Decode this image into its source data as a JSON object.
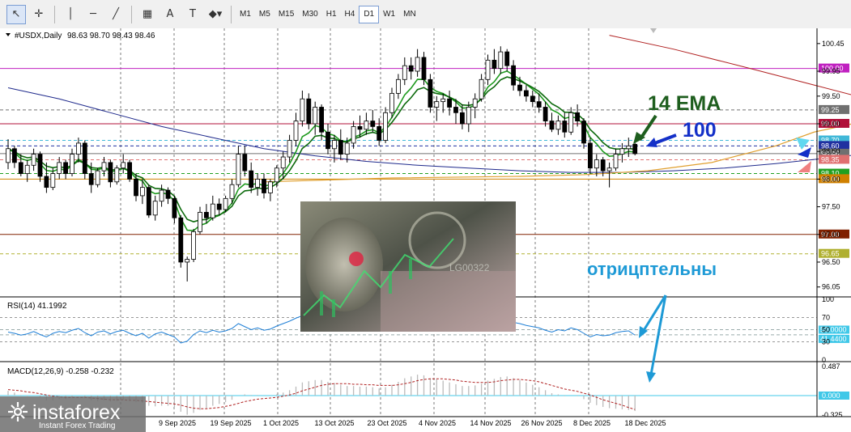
{
  "toolbar": {
    "tools": [
      {
        "name": "cursor-tool",
        "glyph": "↖"
      },
      {
        "name": "crosshair-tool",
        "glyph": "✛"
      },
      {
        "name": "vertical-line-tool",
        "glyph": "│"
      },
      {
        "name": "horizontal-line-tool",
        "glyph": "─"
      },
      {
        "name": "trendline-tool",
        "glyph": "╱"
      },
      {
        "name": "channel-tool",
        "glyph": "▦"
      },
      {
        "name": "text-tool",
        "glyph": "A"
      },
      {
        "name": "label-tool",
        "glyph": "T"
      },
      {
        "name": "shapes-tool",
        "glyph": "◆▾"
      }
    ],
    "timeframes": [
      "M1",
      "M5",
      "M15",
      "M30",
      "H1",
      "H4",
      "D1",
      "W1",
      "MN"
    ],
    "active_timeframe": "D1"
  },
  "chart_title": "#USDX,Daily",
  "ohlc_text": "98.63 98.70 98.43 98.46",
  "rsi_title": "RSI(14) 41.1992",
  "macd_title": "MACD(12,26,9) -0.258 -0.232",
  "annotations": {
    "ema": "14 EMA",
    "ma100": "100",
    "negative": "отрицптельны"
  },
  "watermark": {
    "brand": "instaforex",
    "tagline": "Instant Forex Trading"
  },
  "colors": {
    "bull": "#ffffff",
    "bear": "#000000",
    "ema14": "#1e9a1e",
    "ma100": "#1f2a8c",
    "ma200": "#e0a030",
    "ma_red": "#b02020",
    "rsi": "#1e7fd6",
    "macd": "#b02020",
    "annotation_green": "#1e5e1e",
    "annotation_blue": "#1430c8",
    "annotation_cyan": "#1e9ad6"
  },
  "chart_data": {
    "type": "candlestick",
    "ylim": [
      95.9,
      100.55
    ],
    "price_ticks": [
      100.45,
      99.95,
      99.5,
      99.0,
      98.5,
      98.0,
      97.5,
      97.0,
      96.5,
      96.05
    ],
    "x_labels": [
      "9 Sep 2025",
      "19 Sep 2025",
      "1 Oct 2025",
      "13 Oct 2025",
      "23 Oct 2025",
      "4 Nov 2025",
      "14 Nov 2025",
      "26 Nov 2025",
      "8 Dec 2025",
      "18 Dec 2025"
    ],
    "candles": [
      [
        98.3,
        98.72,
        98.18,
        98.55
      ],
      [
        98.55,
        98.6,
        98.2,
        98.3
      ],
      [
        98.3,
        98.45,
        98.05,
        98.1
      ],
      [
        98.1,
        98.35,
        97.95,
        98.25
      ],
      [
        98.25,
        98.55,
        98.15,
        98.45
      ],
      [
        98.45,
        98.5,
        97.95,
        98.05
      ],
      [
        98.05,
        98.3,
        97.75,
        97.85
      ],
      [
        97.85,
        98.2,
        97.8,
        98.1
      ],
      [
        98.1,
        98.4,
        98.0,
        98.3
      ],
      [
        98.3,
        98.35,
        98.0,
        98.1
      ],
      [
        98.1,
        98.55,
        98.05,
        98.45
      ],
      [
        98.45,
        98.75,
        98.3,
        98.65
      ],
      [
        98.65,
        98.7,
        98.0,
        98.1
      ],
      [
        98.1,
        98.3,
        97.75,
        97.9
      ],
      [
        97.9,
        98.2,
        97.85,
        98.15
      ],
      [
        98.15,
        98.4,
        98.05,
        98.3
      ],
      [
        98.3,
        98.35,
        97.85,
        97.95
      ],
      [
        97.95,
        98.25,
        97.9,
        98.2
      ],
      [
        98.2,
        98.45,
        98.1,
        98.3
      ],
      [
        98.3,
        98.35,
        97.95,
        98.0
      ],
      [
        98.0,
        98.1,
        97.6,
        97.7
      ],
      [
        97.7,
        98.0,
        97.55,
        97.85
      ],
      [
        97.85,
        97.9,
        97.3,
        97.35
      ],
      [
        97.35,
        97.7,
        97.25,
        97.6
      ],
      [
        97.6,
        97.9,
        97.5,
        97.8
      ],
      [
        97.8,
        97.85,
        97.55,
        97.65
      ],
      [
        97.65,
        97.7,
        97.2,
        97.3
      ],
      [
        97.3,
        97.35,
        96.4,
        96.5
      ],
      [
        96.5,
        96.6,
        96.15,
        96.55
      ],
      [
        96.55,
        97.1,
        96.5,
        97.05
      ],
      [
        97.05,
        97.5,
        97.0,
        97.4
      ],
      [
        97.4,
        97.55,
        97.2,
        97.3
      ],
      [
        97.3,
        97.7,
        97.25,
        97.55
      ],
      [
        97.55,
        97.65,
        97.35,
        97.45
      ],
      [
        97.45,
        97.7,
        97.4,
        97.65
      ],
      [
        97.65,
        98.0,
        97.55,
        97.9
      ],
      [
        97.9,
        98.6,
        97.85,
        98.45
      ],
      [
        98.45,
        98.6,
        98.05,
        98.15
      ],
      [
        98.15,
        98.3,
        97.75,
        97.85
      ],
      [
        97.85,
        98.1,
        97.7,
        98.0
      ],
      [
        98.0,
        98.1,
        97.65,
        97.75
      ],
      [
        97.75,
        98.0,
        97.6,
        97.95
      ],
      [
        97.95,
        98.25,
        97.85,
        98.2
      ],
      [
        98.2,
        98.5,
        98.0,
        98.4
      ],
      [
        98.4,
        98.8,
        98.3,
        98.7
      ],
      [
        98.7,
        99.2,
        98.6,
        99.05
      ],
      [
        99.05,
        99.6,
        98.95,
        99.45
      ],
      [
        99.45,
        99.55,
        98.9,
        99.0
      ],
      [
        99.0,
        99.4,
        98.8,
        99.3
      ],
      [
        99.3,
        99.35,
        98.7,
        98.85
      ],
      [
        98.85,
        99.0,
        98.45,
        98.55
      ],
      [
        98.55,
        98.8,
        98.3,
        98.7
      ],
      [
        98.7,
        98.9,
        98.35,
        98.45
      ],
      [
        98.45,
        98.75,
        98.3,
        98.65
      ],
      [
        98.65,
        99.05,
        98.55,
        98.95
      ],
      [
        98.95,
        99.15,
        98.75,
        98.9
      ],
      [
        98.9,
        99.2,
        98.8,
        99.05
      ],
      [
        99.05,
        99.25,
        98.85,
        98.95
      ],
      [
        98.95,
        99.1,
        98.6,
        98.7
      ],
      [
        98.7,
        99.3,
        98.65,
        99.2
      ],
      [
        99.2,
        99.65,
        99.1,
        99.55
      ],
      [
        99.55,
        99.9,
        99.45,
        99.8
      ],
      [
        99.8,
        100.2,
        99.7,
        100.05
      ],
      [
        100.05,
        100.2,
        99.8,
        99.95
      ],
      [
        99.95,
        100.35,
        99.85,
        100.2
      ],
      [
        100.2,
        100.3,
        99.7,
        99.8
      ],
      [
        99.8,
        99.9,
        99.2,
        99.3
      ],
      [
        99.3,
        99.5,
        99.05,
        99.4
      ],
      [
        99.4,
        99.55,
        99.2,
        99.45
      ],
      [
        99.45,
        99.6,
        99.15,
        99.3
      ],
      [
        99.3,
        99.45,
        99.0,
        99.2
      ],
      [
        99.2,
        99.35,
        98.9,
        99.0
      ],
      [
        99.0,
        99.4,
        98.85,
        99.3
      ],
      [
        99.3,
        99.55,
        99.1,
        99.45
      ],
      [
        99.45,
        99.9,
        99.4,
        99.8
      ],
      [
        99.8,
        100.25,
        99.7,
        100.15
      ],
      [
        100.15,
        100.35,
        99.9,
        100.0
      ],
      [
        100.0,
        100.4,
        99.9,
        100.3
      ],
      [
        100.3,
        100.35,
        99.95,
        100.05
      ],
      [
        100.05,
        100.15,
        99.6,
        99.7
      ],
      [
        99.7,
        99.85,
        99.5,
        99.6
      ],
      [
        99.6,
        99.7,
        99.4,
        99.5
      ],
      [
        99.5,
        99.6,
        99.3,
        99.4
      ],
      [
        99.4,
        99.55,
        99.2,
        99.3
      ],
      [
        99.3,
        99.4,
        98.95,
        99.05
      ],
      [
        99.05,
        99.2,
        98.85,
        98.9
      ],
      [
        98.9,
        99.15,
        98.8,
        99.05
      ],
      [
        99.05,
        99.2,
        98.75,
        98.85
      ],
      [
        98.85,
        99.3,
        98.8,
        99.2
      ],
      [
        99.2,
        99.35,
        98.95,
        99.05
      ],
      [
        99.05,
        99.1,
        98.55,
        98.65
      ],
      [
        98.65,
        98.75,
        98.1,
        98.2
      ],
      [
        98.2,
        98.45,
        98.05,
        98.35
      ],
      [
        98.35,
        98.4,
        98.05,
        98.15
      ],
      [
        98.15,
        98.3,
        97.85,
        98.2
      ],
      [
        98.2,
        98.55,
        98.15,
        98.45
      ],
      [
        98.45,
        98.65,
        98.3,
        98.55
      ],
      [
        98.55,
        98.75,
        98.4,
        98.6
      ],
      [
        98.63,
        98.7,
        98.43,
        98.46
      ]
    ],
    "horizontal_levels": [
      {
        "price": 100.0,
        "color": "#c020c0",
        "style": "solid",
        "label": "100.00"
      },
      {
        "price": 99.25,
        "color": "#707070",
        "style": "dash",
        "label": "99.25"
      },
      {
        "price": 99.0,
        "color": "#b0103a",
        "style": "solid",
        "label": "99.00"
      },
      {
        "price": 98.7,
        "color": "#40b8d8",
        "style": "dash",
        "label": "98.70"
      },
      {
        "price": 98.6,
        "color": "#2030a0",
        "style": "dash",
        "label": "98.60"
      },
      {
        "price": 98.46,
        "color": "#707070",
        "style": "solid",
        "label": "98.46"
      },
      {
        "price": 98.35,
        "color": "#e07070",
        "style": "dash",
        "label": "98.35"
      },
      {
        "price": 98.1,
        "color": "#20a020",
        "style": "dash",
        "label": "98.10"
      },
      {
        "price": 98.0,
        "color": "#d08000",
        "style": "solid",
        "label": "98.00"
      },
      {
        "price": 97.0,
        "color": "#802000",
        "style": "solid",
        "label": "97.00"
      },
      {
        "price": 96.65,
        "color": "#b0b030",
        "style": "dash",
        "label": "96.65"
      }
    ],
    "ma100": [
      [
        0,
        99.65
      ],
      [
        8,
        99.45
      ],
      [
        16,
        99.2
      ],
      [
        24,
        98.95
      ],
      [
        32,
        98.75
      ],
      [
        40,
        98.55
      ],
      [
        48,
        98.42
      ],
      [
        56,
        98.32
      ],
      [
        64,
        98.25
      ],
      [
        72,
        98.2
      ],
      [
        80,
        98.15
      ],
      [
        88,
        98.12
      ],
      [
        96,
        98.12
      ],
      [
        104,
        98.15
      ],
      [
        112,
        98.2
      ],
      [
        120,
        98.28
      ],
      [
        128,
        98.38
      ],
      [
        136,
        98.48
      ],
      [
        144,
        98.55
      ],
      [
        152,
        98.58
      ],
      [
        160,
        98.6
      ]
    ],
    "ma200": [
      [
        40,
        97.95
      ],
      [
        60,
        98.02
      ],
      [
        80,
        98.05
      ],
      [
        90,
        98.08
      ],
      [
        100,
        98.15
      ],
      [
        110,
        98.3
      ],
      [
        120,
        98.6
      ],
      [
        126,
        98.85
      ],
      [
        132,
        99.0
      ],
      [
        138,
        99.15
      ],
      [
        144,
        99.22
      ],
      [
        150,
        99.2
      ],
      [
        157,
        99.15
      ]
    ],
    "ma_red": [
      [
        94,
        100.6
      ],
      [
        104,
        100.35
      ],
      [
        116,
        100.0
      ],
      [
        126,
        99.7
      ],
      [
        136,
        99.4
      ],
      [
        144,
        99.2
      ],
      [
        150,
        99.1
      ],
      [
        157,
        99.1
      ]
    ],
    "rsi": {
      "ticks": [
        100,
        70,
        50,
        30,
        0
      ],
      "levels": [
        {
          "value": 50.0,
          "label": "50.0000",
          "color": "#40c8e8"
        },
        {
          "value": 41.44,
          "label": "41.4400",
          "color": "#40c8e8"
        }
      ],
      "values": [
        46,
        44,
        41,
        43,
        47,
        42,
        38,
        44,
        47,
        45,
        49,
        52,
        45,
        40,
        46,
        48,
        43,
        47,
        49,
        44,
        40,
        44,
        36,
        43,
        46,
        42,
        38,
        28,
        31,
        42,
        48,
        45,
        49,
        46,
        48,
        52,
        60,
        55,
        50,
        53,
        49,
        51,
        56,
        60,
        64,
        69,
        73,
        66,
        68,
        62,
        56,
        59,
        55,
        58,
        62,
        61,
        63,
        60,
        57,
        64,
        69,
        73,
        76,
        72,
        74,
        66,
        59,
        61,
        62,
        60,
        57,
        55,
        60,
        63,
        68,
        72,
        70,
        72,
        67,
        62,
        60,
        57,
        55,
        53,
        49,
        46,
        50,
        48,
        53,
        50,
        44,
        38,
        42,
        40,
        41,
        45,
        47,
        48,
        41
      ]
    },
    "macd": {
      "ticks": [
        0.487,
        0.0,
        -0.325
      ],
      "zero_label": "0.000",
      "hist": [
        0.08,
        0.05,
        0.01,
        -0.01,
        0.0,
        -0.03,
        -0.08,
        -0.08,
        -0.06,
        -0.06,
        -0.03,
        0.0,
        -0.03,
        -0.08,
        -0.09,
        -0.08,
        -0.1,
        -0.09,
        -0.07,
        -0.08,
        -0.11,
        -0.12,
        -0.17,
        -0.18,
        -0.17,
        -0.17,
        -0.19,
        -0.27,
        -0.32,
        -0.29,
        -0.24,
        -0.21,
        -0.17,
        -0.14,
        -0.11,
        -0.07,
        0.0,
        0.02,
        0.01,
        0.01,
        0.0,
        0.0,
        0.02,
        0.05,
        0.09,
        0.15,
        0.22,
        0.24,
        0.26,
        0.26,
        0.23,
        0.21,
        0.18,
        0.16,
        0.16,
        0.15,
        0.15,
        0.14,
        0.12,
        0.14,
        0.18,
        0.23,
        0.29,
        0.32,
        0.35,
        0.34,
        0.29,
        0.27,
        0.25,
        0.22,
        0.19,
        0.16,
        0.16,
        0.17,
        0.2,
        0.25,
        0.28,
        0.31,
        0.32,
        0.29,
        0.26,
        0.22,
        0.18,
        0.14,
        0.09,
        0.04,
        0.02,
        -0.01,
        0.0,
        -0.01,
        -0.06,
        -0.12,
        -0.16,
        -0.19,
        -0.21,
        -0.22,
        -0.23,
        -0.24,
        -0.258
      ],
      "signal": [
        0.1,
        0.09,
        0.08,
        0.06,
        0.05,
        0.03,
        0.01,
        -0.01,
        -0.02,
        -0.03,
        -0.03,
        -0.03,
        -0.03,
        -0.04,
        -0.05,
        -0.06,
        -0.07,
        -0.07,
        -0.07,
        -0.08,
        -0.08,
        -0.09,
        -0.1,
        -0.11,
        -0.12,
        -0.13,
        -0.14,
        -0.16,
        -0.19,
        -0.21,
        -0.22,
        -0.22,
        -0.21,
        -0.2,
        -0.18,
        -0.16,
        -0.13,
        -0.1,
        -0.08,
        -0.06,
        -0.05,
        -0.04,
        -0.03,
        -0.01,
        0.01,
        0.04,
        0.08,
        0.11,
        0.14,
        0.17,
        0.19,
        0.2,
        0.2,
        0.2,
        0.19,
        0.19,
        0.18,
        0.18,
        0.17,
        0.17,
        0.17,
        0.18,
        0.2,
        0.22,
        0.25,
        0.27,
        0.28,
        0.28,
        0.28,
        0.27,
        0.26,
        0.24,
        0.23,
        0.22,
        0.22,
        0.22,
        0.23,
        0.25,
        0.26,
        0.27,
        0.27,
        0.26,
        0.25,
        0.23,
        0.2,
        0.17,
        0.14,
        0.11,
        0.09,
        0.07,
        0.04,
        0.01,
        -0.03,
        -0.07,
        -0.1,
        -0.13,
        -0.16,
        -0.2,
        -0.232
      ]
    }
  }
}
